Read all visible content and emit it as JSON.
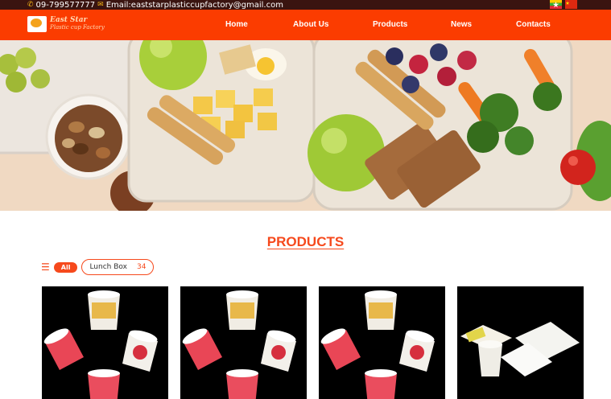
{
  "topbar": {
    "phone": "09-799577777",
    "email": "Email:eaststarplasticcupfactory@gmail.com",
    "phone_icon": "phone-icon",
    "email_icon": "envelope-icon"
  },
  "brand": {
    "name_line1": "East Star",
    "name_line2": "Plastic cup Factory"
  },
  "nav": {
    "items": [
      "Home",
      "About Us",
      "Products",
      "News",
      "Contacts"
    ]
  },
  "products": {
    "title": "PRODUCTS",
    "filter_all": "All",
    "categories": [
      {
        "label": "Lunch Box",
        "count": "34"
      }
    ]
  },
  "colors": {
    "accent": "#fb3c00",
    "topbar": "#3a1410",
    "title": "#f6491c"
  }
}
